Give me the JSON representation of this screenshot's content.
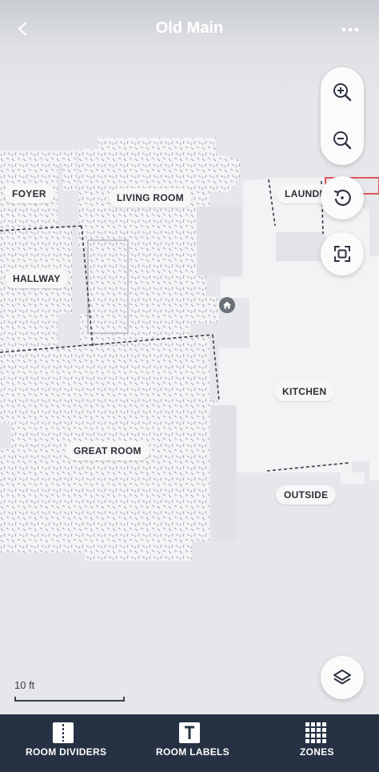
{
  "header": {
    "title": "Old Main",
    "back_icon": "chevron-left-icon",
    "more_icon": "more-horizontal-icon"
  },
  "rooms": {
    "foyer": "FOYER",
    "living_room": "LIVING ROOM",
    "laundry": "LAUNDRY",
    "hallway": "HALLWAY",
    "kitchen": "KITCHEN",
    "great_room": "GREAT ROOM",
    "outside": "OUTSIDE"
  },
  "map_controls": {
    "zoom_in_icon": "zoom-in-icon",
    "zoom_out_icon": "zoom-out-icon",
    "rotate_icon": "rotate-icon",
    "fit_icon": "fit-to-screen-icon",
    "layers_icon": "layers-icon",
    "dock_icon": "home-icon"
  },
  "scale": {
    "label": "10 ft"
  },
  "tabbar": {
    "room_dividers": "ROOM DIVIDERS",
    "room_labels": "ROOM LABELS",
    "zones": "ZONES"
  },
  "colors": {
    "tabbar_bg": "#263244",
    "floor": "#f2f2f4",
    "carpet_pattern": "#9aa0a8",
    "dock": "#6b7178",
    "highlight": "#e0575b"
  }
}
